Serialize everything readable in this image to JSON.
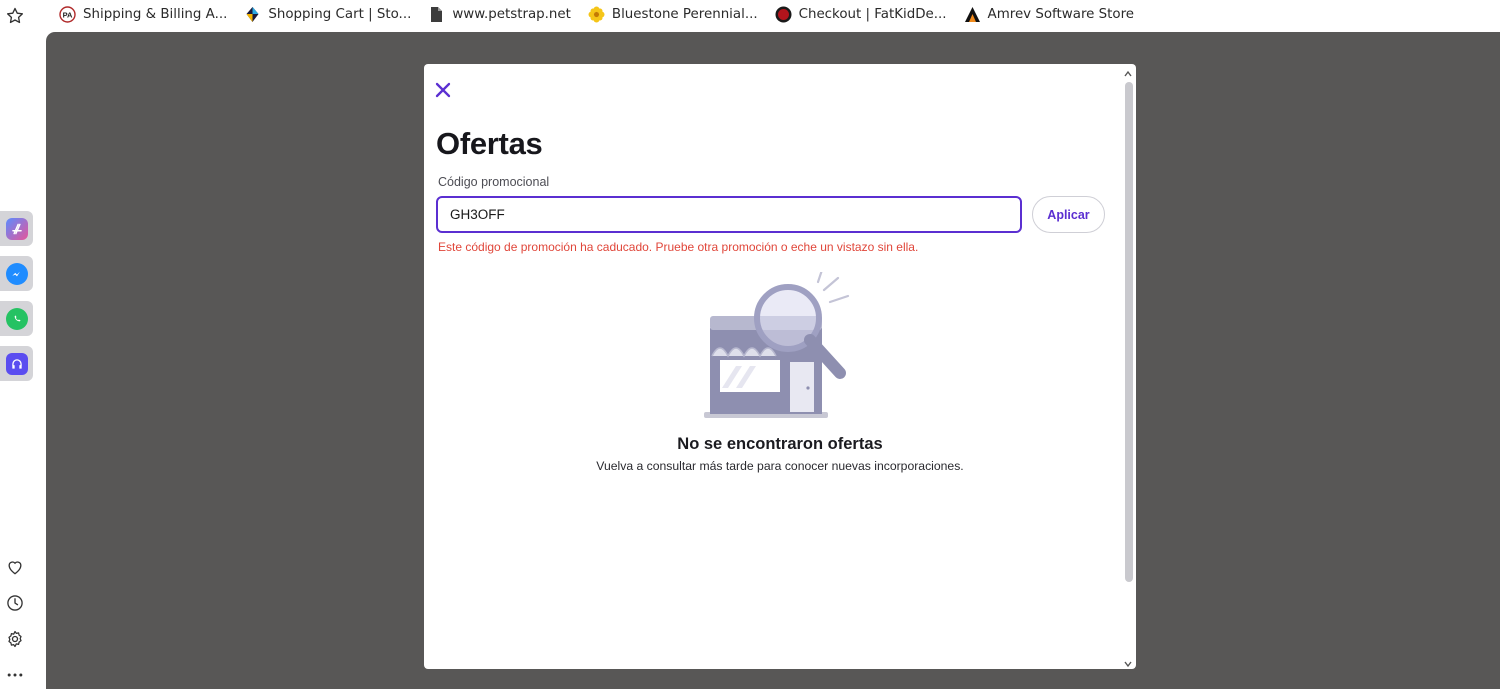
{
  "bookmarks": [
    {
      "label": "Shipping & Billing A...",
      "icon": "pa-logo-icon"
    },
    {
      "label": "Shopping Cart | Sto...",
      "icon": "diamond-logo-icon"
    },
    {
      "label": "www.petstrap.net",
      "icon": "page-icon"
    },
    {
      "label": "Bluestone Perennial...",
      "icon": "flower-icon"
    },
    {
      "label": "Checkout | FatKidDe...",
      "icon": "circle-logo-icon"
    },
    {
      "label": "Amrev Software Store",
      "icon": "triangle-logo-icon"
    }
  ],
  "sidebar": {
    "top_icon": "star-outline-icon",
    "apps": [
      "app-store-icon",
      "messenger-icon",
      "whatsapp-icon",
      "headphones-app-icon"
    ],
    "bottom_icons": [
      "heart-icon",
      "clock-icon",
      "gear-icon",
      "more-icon"
    ]
  },
  "modal": {
    "title": "Ofertas",
    "promo_label": "Código promocional",
    "promo_value": "GH3OFF",
    "apply_label": "Aplicar",
    "error_message": "Este código de promoción ha caducado. Pruebe otra promoción o eche un vistazo sin ella.",
    "empty_title": "No se encontraron ofertas",
    "empty_subtitle": "Vuelva a consultar más tarde para conocer nuevas incorporaciones."
  },
  "colors": {
    "accent": "#5b2fd1",
    "error": "#e0463a",
    "backdrop": "#585756"
  }
}
